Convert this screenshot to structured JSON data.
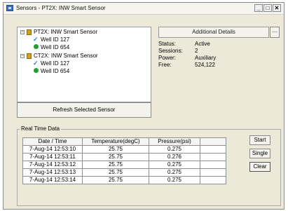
{
  "window": {
    "title": "Sensors - PT2X: INW Smart Sensor",
    "controls": [
      "_",
      "□",
      "✕"
    ]
  },
  "tree": {
    "items": [
      {
        "type": "sensor",
        "label": "PT2X: INW Smart Sensor",
        "expander": "−",
        "icon": "sensor-icon"
      },
      {
        "type": "check-child",
        "label": "Well ID 127",
        "icon": "check-icon"
      },
      {
        "type": "dot-child",
        "label": "Well ID 654",
        "icon": "green-dot-icon"
      },
      {
        "type": "sensor",
        "label": "CT2X: INW Smart Sensor",
        "expander": "−",
        "icon": "sensor-icon"
      },
      {
        "type": "check-child",
        "label": "Well ID 127",
        "icon": "check-icon"
      },
      {
        "type": "dot-child",
        "label": "Well ID 654",
        "icon": "green-dot-icon"
      }
    ]
  },
  "buttons": {
    "refresh": "Refresh Selected Sensor",
    "more": "...",
    "start": "Start",
    "single": "Single",
    "clear": "Clear"
  },
  "details": {
    "header": "Additional Details",
    "status_label": "Status:",
    "status_value": "Active",
    "sessions_label": "Sessions:",
    "sessions_value": "2",
    "power_label": "Power:",
    "power_value": "Auxiliary",
    "free_label": "Free:",
    "free_value": "524,122"
  },
  "realtime": {
    "label": "Real Time Data",
    "columns": [
      "Date / Time",
      "Temperature(degC)",
      "Pressure(psi)"
    ],
    "rows": [
      [
        "7-Aug-14 12:53:10",
        "25.75",
        "0.275"
      ],
      [
        "7-Aug-14 12:53:11",
        "25.75",
        "0.276"
      ],
      [
        "7-Aug-14 12:53:12",
        "25.75",
        "0.275"
      ],
      [
        "7-Aug-14 12:53:13",
        "25.75",
        "0.275"
      ],
      [
        "7-Aug-14 12:53:14",
        "25.75",
        "0.275"
      ]
    ]
  },
  "colors": {
    "window_bg": "#ece9d8",
    "sensor_icon": "#d2a01c",
    "check": "#2a7fd0",
    "green_dot": "#22a02e"
  }
}
